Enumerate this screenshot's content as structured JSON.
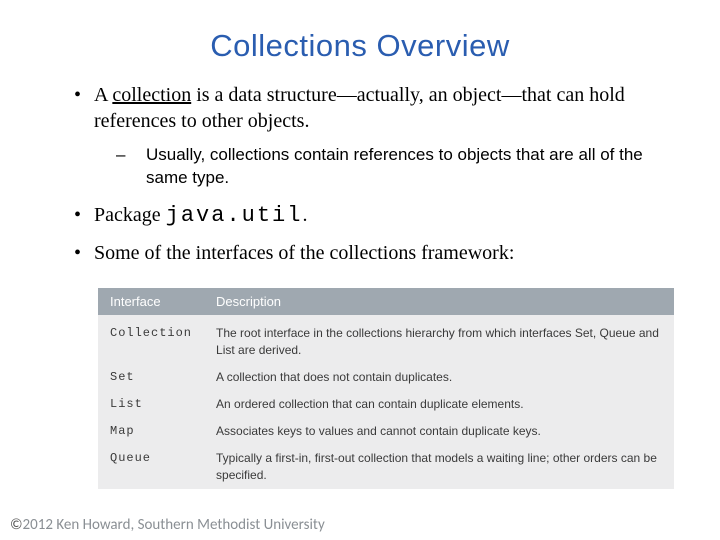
{
  "title": "Collections Overview",
  "bullets": {
    "b1_pre": "A ",
    "b1_underlined": "collection",
    "b1_post": " is a data structure—actually, an object—that can hold references to other objects.",
    "b1_sub": "Usually, collections contain references to objects that are all of the same type.",
    "b2_pre": "Package ",
    "b2_mono": "java.util",
    "b2_post": ".",
    "b3": "Some of the interfaces of the collections framework:"
  },
  "table": {
    "head_interface": "Interface",
    "head_description": "Description",
    "rows": [
      {
        "iface": "Collection",
        "desc": "The root interface in the collections hierarchy from which interfaces Set, Queue and List are derived."
      },
      {
        "iface": "Set",
        "desc": "A collection that does not contain duplicates."
      },
      {
        "iface": "List",
        "desc": "An ordered collection that can contain duplicate elements."
      },
      {
        "iface": "Map",
        "desc": "Associates keys to values and cannot contain duplicate keys."
      },
      {
        "iface": "Queue",
        "desc": "Typically a first-in, first-out collection that models a waiting line; other orders can be specified."
      }
    ]
  },
  "footer": {
    "copyright_year": "2012",
    "author": "Ken Howard, Southern Methodist University"
  }
}
